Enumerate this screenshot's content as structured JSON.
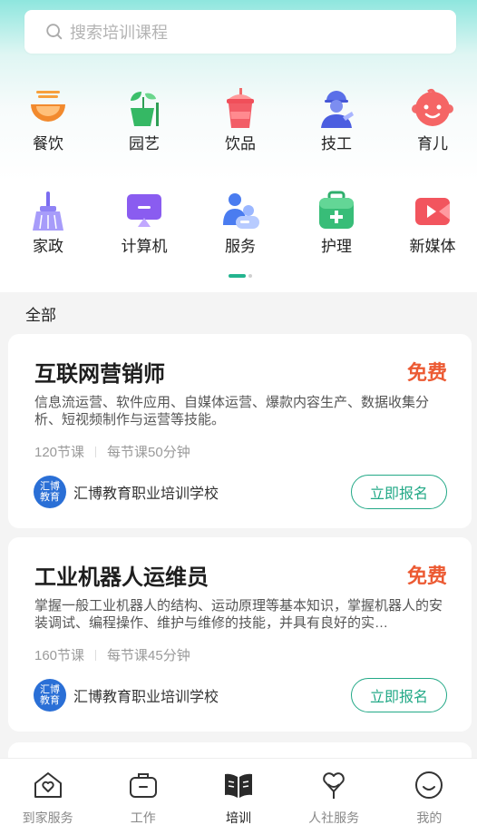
{
  "search": {
    "placeholder": "搜索培训课程"
  },
  "categories": [
    {
      "label": "餐饮",
      "icon": "food-bowl-icon"
    },
    {
      "label": "园艺",
      "icon": "plant-pot-icon"
    },
    {
      "label": "饮品",
      "icon": "drink-cup-icon"
    },
    {
      "label": "技工",
      "icon": "worker-icon"
    },
    {
      "label": "育儿",
      "icon": "baby-face-icon"
    },
    {
      "label": "家政",
      "icon": "broom-icon"
    },
    {
      "label": "计算机",
      "icon": "computer-icon"
    },
    {
      "label": "服务",
      "icon": "people-icon"
    },
    {
      "label": "护理",
      "icon": "medical-kit-icon"
    },
    {
      "label": "新媒体",
      "icon": "video-camera-icon"
    }
  ],
  "section_label": "全部",
  "courses": [
    {
      "title": "互联网营销师",
      "price": "免费",
      "desc": "信息流运营、软件应用、自媒体运营、爆款内容生产、数据收集分析、短视频制作与运营等技能。",
      "lessons": "120节课",
      "duration": "每节课50分钟",
      "school": "汇博教育职业培训学校",
      "logo_text": "汇博教育",
      "apply_label": "立即报名"
    },
    {
      "title": "工业机器人运维员",
      "price": "免费",
      "desc": "掌握一般工业机器人的结构、运动原理等基本知识，掌握机器人的安装调试、编程操作、维护与维修的技能，并具有良好的实…",
      "lessons": "160节课",
      "duration": "每节课45分钟",
      "school": "汇博教育职业培训学校",
      "logo_text": "汇博教育",
      "apply_label": "立即报名"
    }
  ],
  "tabs": [
    {
      "label": "到家服务",
      "icon": "home-heart-icon",
      "active": false
    },
    {
      "label": "工作",
      "icon": "briefcase-icon",
      "active": false
    },
    {
      "label": "培训",
      "icon": "open-book-icon",
      "active": true
    },
    {
      "label": "人社服务",
      "icon": "heart-person-icon",
      "active": false
    },
    {
      "label": "我的",
      "icon": "smile-icon",
      "active": false
    }
  ],
  "colors": {
    "accent": "#23a987",
    "price": "#ec5a33",
    "logo": "#2a6fd6"
  }
}
